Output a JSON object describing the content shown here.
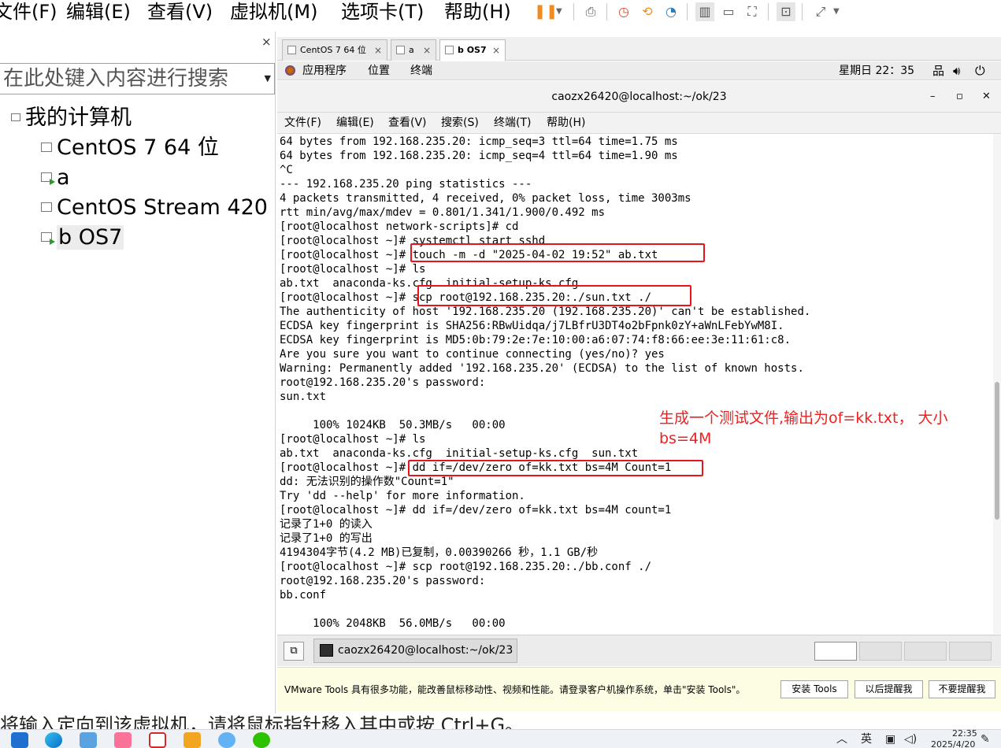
{
  "menubar": {
    "file": "文件(F)",
    "edit": "编辑(E)",
    "view": "查看(V)",
    "vm": "虚拟机(M)",
    "tabs": "选项卡(T)",
    "help": "帮助(H)"
  },
  "toolbar_icons": [
    "pause-icon",
    "send-ctrl-alt-del-icon",
    "snapshot-icon",
    "revert-snapshot-icon",
    "snapshot-manager-icon",
    "library-view-icon",
    "normal-view-icon",
    "fullscreen-icon",
    "console-icon",
    "stretch-icon"
  ],
  "library": {
    "close": "×",
    "search_placeholder": "在此处键入内容进行搜索",
    "root": "我的计算机",
    "items": [
      "CentOS 7 64 位",
      "a",
      "CentOS Stream 420",
      "b OS7"
    ]
  },
  "vm_tabs": [
    {
      "label": "CentOS 7 64 位",
      "close": "×"
    },
    {
      "label": "a",
      "close": "×"
    },
    {
      "label": "b OS7",
      "close": "×"
    }
  ],
  "gnome": {
    "applications": "应用程序",
    "places": "位置",
    "terminal": "终端",
    "clock": "星期日 22：35"
  },
  "terminal": {
    "title": "caozx26420@localhost:~/ok/23",
    "minimize": "–",
    "maximize": "▫",
    "close": "✕",
    "menu": [
      "文件(F)",
      "编辑(E)",
      "查看(V)",
      "搜索(S)",
      "终端(T)",
      "帮助(H)"
    ],
    "lines": [
      "64 bytes from 192.168.235.20: icmp_seq=3 ttl=64 time=1.75 ms",
      "64 bytes from 192.168.235.20: icmp_seq=4 ttl=64 time=1.90 ms",
      "^C",
      "--- 192.168.235.20 ping statistics ---",
      "4 packets transmitted, 4 received, 0% packet loss, time 3003ms",
      "rtt min/avg/max/mdev = 0.801/1.341/1.900/0.492 ms",
      "[root@localhost network-scripts]# cd",
      "[root@localhost ~]# systemctl start sshd",
      "[root@localhost ~]# touch -m -d \"2025-04-02 19:52\" ab.txt",
      "[root@localhost ~]# ls",
      "ab.txt  anaconda-ks.cfg  initial-setup-ks.cfg",
      "[root@localhost ~]# scp root@192.168.235.20:./sun.txt ./",
      "The authenticity of host '192.168.235.20 (192.168.235.20)' can't be established.",
      "ECDSA key fingerprint is SHA256:RBwUidqa/j7LBfrU3DT4o2bFpnk0zY+aWnLFebYwM8I.",
      "ECDSA key fingerprint is MD5:0b:79:2e:7e:10:00:a6:07:74:f8:66:ee:3e:11:61:c8.",
      "Are you sure you want to continue connecting (yes/no)? yes",
      "Warning: Permanently added '192.168.235.20' (ECDSA) to the list of known hosts.",
      "root@192.168.235.20's password:",
      "sun.txt",
      "",
      "     100% 1024KB  50.3MB/s   00:00",
      "[root@localhost ~]# ls",
      "ab.txt  anaconda-ks.cfg  initial-setup-ks.cfg  sun.txt",
      "[root@localhost ~]# dd if=/dev/zero of=kk.txt bs=4M Count=1",
      "dd: 无法识别的操作数\"Count=1\"",
      "Try 'dd --help' for more information.",
      "[root@localhost ~]# dd if=/dev/zero of=kk.txt bs=4M count=1",
      "记录了1+0 的读入",
      "记录了1+0 的写出",
      "4194304字节(4.2 MB)已复制，0.00390266 秒，1.1 GB/秒",
      "[root@localhost ~]# scp root@192.168.235.20:./bb.conf ./",
      "root@192.168.235.20's password:",
      "bb.conf",
      "",
      "     100% 2048KB  56.0MB/s   00:00"
    ]
  },
  "annotation": "生成一个测试文件,输出为of=kk.txt， 大小bs=4M",
  "guest_taskbar": {
    "task": "caozx26420@localhost:~/ok/23"
  },
  "tools_notice": {
    "message": "VMware Tools 具有很多功能，能改善鼠标移动性、视频和性能。请登录客户机操作系统，单击\"安装 Tools\"。",
    "install": "安装 Tools",
    "later": "以后提醒我",
    "never": "不要提醒我"
  },
  "host_status": "将输入定向到该虚拟机，请将鼠标指针移入其中或按 Ctrl+G。",
  "win_taskbar": {
    "apps": [
      "windows-start-icon",
      "edge-icon",
      "photos-icon",
      "bilibili-icon",
      "wps-icon",
      "screenshot-app-icon",
      "cloud-app-icon",
      "wechat-icon"
    ],
    "ime": "英",
    "time": "22:35",
    "date": "2025/4/20"
  },
  "colors": {
    "annotation_red": "#e8141b",
    "tools_bg": "#fdfde3",
    "terminal_bg": "#ffffff"
  }
}
